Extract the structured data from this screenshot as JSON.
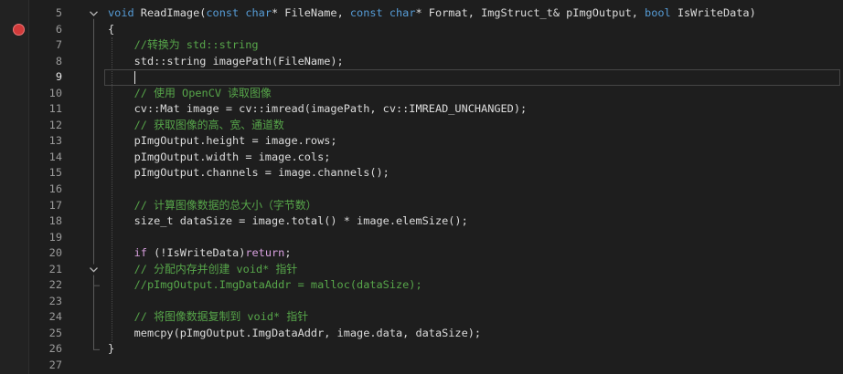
{
  "editor": {
    "colors": {
      "background": "#1e1e1e",
      "text": "#dcdcdc",
      "keyword": "#569cd6",
      "control_keyword": "#d8a0df",
      "comment": "#57a64a",
      "line_number": "#9a9a9a",
      "current_line_number": "#e8e8e8",
      "breakpoint": "#d13a3a",
      "fold_marker": "#b8b8b8",
      "fold_line": "#5a5a5a"
    },
    "breakpoints": [
      6
    ],
    "cursor": {
      "line": 9,
      "char": 5
    },
    "folds": [
      {
        "start": 5,
        "end": 26
      },
      {
        "start": 21,
        "end": 22
      }
    ],
    "lines": [
      {
        "n": 5,
        "tokens": [
          {
            "kw": "void"
          },
          {
            "tx": " ReadImage("
          },
          {
            "kw": "const char"
          },
          {
            "tx": "* FileName, "
          },
          {
            "kw": "const char"
          },
          {
            "tx": "* Format, ImgStruct_t& pImgOutput, "
          },
          {
            "kw": "bool"
          },
          {
            "tx": " IsWriteData)"
          }
        ]
      },
      {
        "n": 6,
        "tokens": [
          {
            "tx": "{"
          }
        ]
      },
      {
        "n": 7,
        "tokens": [
          {
            "tx": "    "
          },
          {
            "cm": "//转换为 std::string"
          }
        ]
      },
      {
        "n": 8,
        "tokens": [
          {
            "tx": "    std::string imagePath(FileName);"
          }
        ]
      },
      {
        "n": 9,
        "tokens": []
      },
      {
        "n": 10,
        "tokens": [
          {
            "tx": "    "
          },
          {
            "cm": "// 使用 OpenCV 读取图像"
          }
        ]
      },
      {
        "n": 11,
        "tokens": [
          {
            "tx": "    cv::Mat image = cv::imread(imagePath, cv::IMREAD_UNCHANGED);"
          }
        ]
      },
      {
        "n": 12,
        "tokens": [
          {
            "tx": "    "
          },
          {
            "cm": "// 获取图像的高、宽、通道数"
          }
        ]
      },
      {
        "n": 13,
        "tokens": [
          {
            "tx": "    pImgOutput.height = image.rows;"
          }
        ]
      },
      {
        "n": 14,
        "tokens": [
          {
            "tx": "    pImgOutput.width = image.cols;"
          }
        ]
      },
      {
        "n": 15,
        "tokens": [
          {
            "tx": "    pImgOutput.channels = image.channels();"
          }
        ]
      },
      {
        "n": 16,
        "tokens": []
      },
      {
        "n": 17,
        "tokens": [
          {
            "tx": "    "
          },
          {
            "cm": "// 计算图像数据的总大小（字节数）"
          }
        ]
      },
      {
        "n": 18,
        "tokens": [
          {
            "tx": "    size_t dataSize = image.total() * image.elemSize();"
          }
        ]
      },
      {
        "n": 19,
        "tokens": []
      },
      {
        "n": 20,
        "tokens": [
          {
            "tx": "    "
          },
          {
            "ctl": "if"
          },
          {
            "tx": " (!IsWriteData)"
          },
          {
            "ctl": "return"
          },
          {
            "tx": ";"
          }
        ]
      },
      {
        "n": 21,
        "tokens": [
          {
            "tx": "    "
          },
          {
            "cm": "// 分配内存并创建 void* 指针"
          }
        ]
      },
      {
        "n": 22,
        "tokens": [
          {
            "tx": "    "
          },
          {
            "cm": "//pImgOutput.ImgDataAddr = malloc(dataSize);"
          }
        ]
      },
      {
        "n": 23,
        "tokens": []
      },
      {
        "n": 24,
        "tokens": [
          {
            "tx": "    "
          },
          {
            "cm": "// 将图像数据复制到 void* 指针"
          }
        ]
      },
      {
        "n": 25,
        "tokens": [
          {
            "tx": "    memcpy(pImgOutput.ImgDataAddr, image.data, dataSize);"
          }
        ]
      },
      {
        "n": 26,
        "tokens": [
          {
            "tx": "}"
          }
        ]
      },
      {
        "n": 27,
        "tokens": []
      }
    ]
  }
}
